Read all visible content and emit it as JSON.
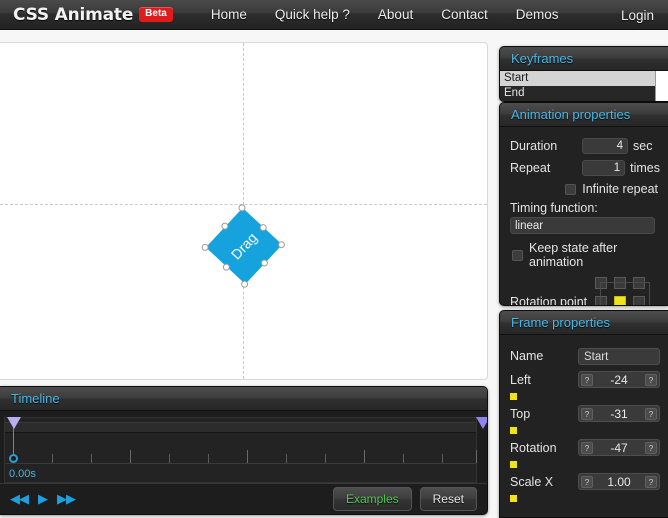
{
  "header": {
    "brand": "CSS Animate",
    "beta_badge": "Beta",
    "nav": [
      {
        "label": "Home"
      },
      {
        "label": "Quick help ?"
      },
      {
        "label": "About"
      },
      {
        "label": "Contact"
      },
      {
        "label": "Demos"
      }
    ],
    "login": "Login"
  },
  "stage": {
    "element_label": "Drag",
    "element_color": "#16a3dd"
  },
  "timeline": {
    "title": "Timeline",
    "timecode": "0.00s",
    "transport": [
      {
        "name": "rewind-icon",
        "glyph": "◀◀"
      },
      {
        "name": "play-icon",
        "glyph": "▶"
      },
      {
        "name": "forward-icon",
        "glyph": "▶▶"
      }
    ],
    "examples_label": "Examples",
    "reset_label": "Reset",
    "examples_color": "#4fc94f"
  },
  "keyframes": {
    "title": "Keyframes",
    "items": [
      {
        "label": "Start",
        "selected": true
      },
      {
        "label": "End",
        "selected": false
      }
    ]
  },
  "animation_properties": {
    "title": "Animation properties",
    "duration_label": "Duration",
    "duration_value": "4",
    "duration_unit": "sec",
    "repeat_label": "Repeat",
    "repeat_value": "1",
    "repeat_unit": "times",
    "infinite_repeat_label": "Infinite repeat",
    "infinite_repeat_checked": false,
    "timing_function_label": "Timing function:",
    "timing_function_value": "linear",
    "keep_state_label": "Keep state after animation",
    "keep_state_checked": false,
    "rotation_point_label": "Rotation point",
    "rotation_point_selected": "center",
    "rotation_point_color": "#f2e21a"
  },
  "frame_properties": {
    "title": "Frame properties",
    "name_label": "Name",
    "name_value": "Start",
    "rows": [
      {
        "label": "Left",
        "value": "-24",
        "dec": "?",
        "inc": "?"
      },
      {
        "label": "Top",
        "value": "-31",
        "dec": "?",
        "inc": "?"
      },
      {
        "label": "Rotation",
        "value": "-47",
        "dec": "?",
        "inc": "?"
      },
      {
        "label": "Scale X",
        "value": "1.00",
        "dec": "?",
        "inc": "?"
      }
    ]
  }
}
